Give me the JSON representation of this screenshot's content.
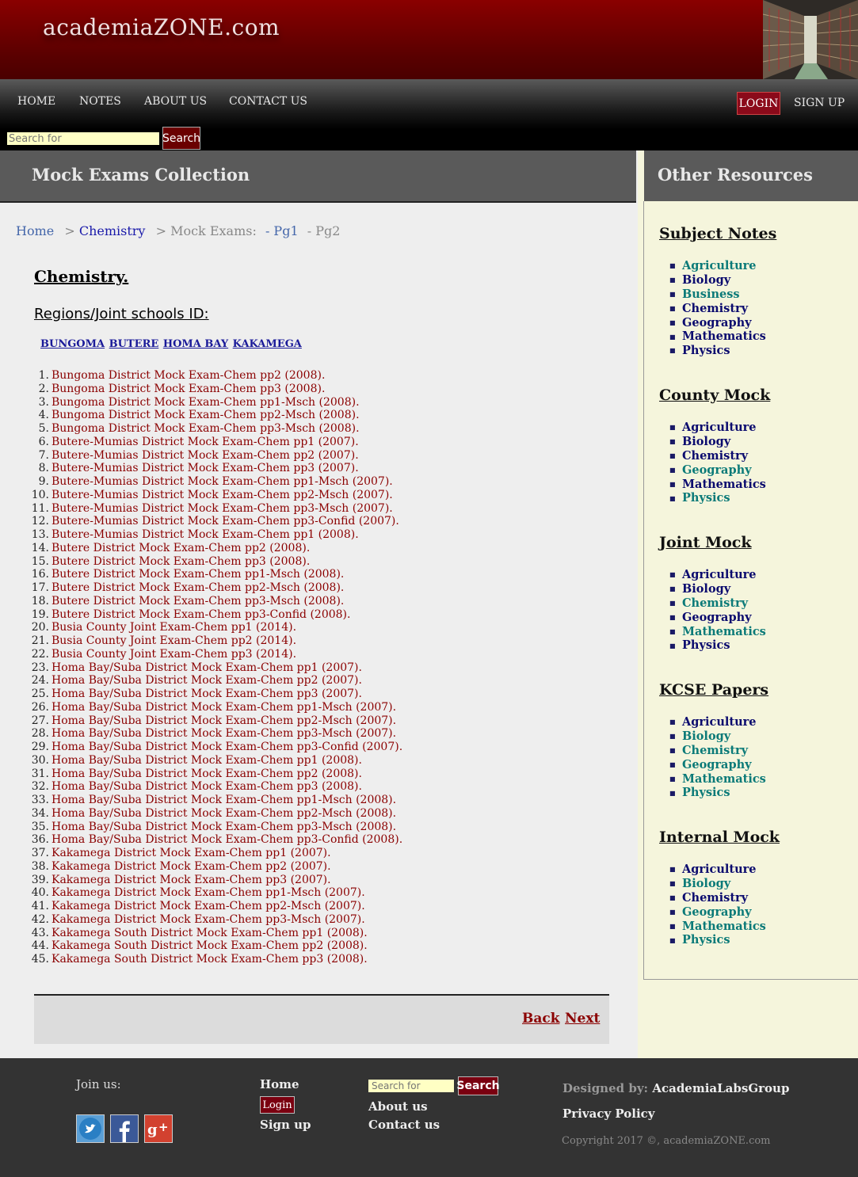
{
  "site": {
    "title": "academiaZONE.com"
  },
  "nav": {
    "items": [
      "HOME",
      "NOTES",
      "ABOUT US",
      "CONTACT US"
    ],
    "login": "LOGIN",
    "signup": "SIGN UP",
    "search_placeholder": "Search for",
    "search_button": "Search"
  },
  "main": {
    "title": "Mock Exams Collection",
    "breadcrumb": {
      "home": "Home",
      "sep": ">",
      "chemistry": "Chemistry",
      "current": "Mock Exams:",
      "pg1": "- Pg1",
      "pg2": "- Pg2"
    },
    "subject_heading": "Chemistry.",
    "regions_heading": "Regions/Joint schools ID:",
    "regions": [
      "BUNGOMA",
      "BUTERE",
      "HOMA BAY",
      "KAKAMEGA"
    ],
    "exams": [
      "Bungoma District Mock Exam-Chem pp2 (2008).",
      "Bungoma District Mock Exam-Chem pp3 (2008).",
      "Bungoma District Mock Exam-Chem pp1-Msch (2008).",
      "Bungoma District Mock Exam-Chem pp2-Msch (2008).",
      "Bungoma District Mock Exam-Chem pp3-Msch (2008).",
      "Butere-Mumias District Mock Exam-Chem pp1 (2007).",
      "Butere-Mumias District Mock Exam-Chem pp2 (2007).",
      "Butere-Mumias District Mock Exam-Chem pp3 (2007).",
      "Butere-Mumias District Mock Exam-Chem pp1-Msch (2007).",
      "Butere-Mumias District Mock Exam-Chem pp2-Msch (2007).",
      "Butere-Mumias District Mock Exam-Chem pp3-Msch (2007).",
      "Butere-Mumias District Mock Exam-Chem pp3-Confid (2007).",
      "Butere-Mumias District Mock Exam-Chem pp1 (2008).",
      "Butere District Mock Exam-Chem pp2 (2008).",
      "Butere District Mock Exam-Chem pp3 (2008).",
      "Butere District Mock Exam-Chem pp1-Msch (2008).",
      "Butere District Mock Exam-Chem pp2-Msch (2008).",
      "Butere District Mock Exam-Chem pp3-Msch (2008).",
      "Butere District Mock Exam-Chem pp3-Confid (2008).",
      "Busia County Joint Exam-Chem pp1 (2014).",
      "Busia County Joint Exam-Chem pp2 (2014).",
      "Busia County Joint Exam-Chem pp3 (2014).",
      "Homa Bay/Suba District Mock Exam-Chem pp1 (2007).",
      "Homa Bay/Suba District Mock Exam-Chem pp2 (2007).",
      "Homa Bay/Suba District Mock Exam-Chem pp3 (2007).",
      "Homa Bay/Suba District Mock Exam-Chem pp1-Msch (2007).",
      "Homa Bay/Suba District Mock Exam-Chem pp2-Msch (2007).",
      "Homa Bay/Suba District Mock Exam-Chem pp3-Msch (2007).",
      "Homa Bay/Suba District Mock Exam-Chem pp3-Confid (2007).",
      "Homa Bay/Suba District Mock Exam-Chem pp1 (2008).",
      "Homa Bay/Suba District Mock Exam-Chem pp2 (2008).",
      "Homa Bay/Suba District Mock Exam-Chem pp3 (2008).",
      "Homa Bay/Suba District Mock Exam-Chem pp1-Msch (2008).",
      "Homa Bay/Suba District Mock Exam-Chem pp2-Msch (2008).",
      "Homa Bay/Suba District Mock Exam-Chem pp3-Msch (2008).",
      "Homa Bay/Suba District Mock Exam-Chem pp3-Confid (2008).",
      "Kakamega District Mock Exam-Chem pp1 (2007).",
      "Kakamega District Mock Exam-Chem pp2 (2007).",
      "Kakamega District Mock Exam-Chem pp3 (2007).",
      "Kakamega District Mock Exam-Chem pp1-Msch (2007).",
      "Kakamega District Mock Exam-Chem pp2-Msch (2007).",
      "Kakamega District Mock Exam-Chem pp3-Msch (2007).",
      "Kakamega South District Mock Exam-Chem pp1 (2008).",
      "Kakamega South District Mock Exam-Chem pp2 (2008).",
      "Kakamega South District Mock Exam-Chem pp3 (2008)."
    ],
    "back": "Back",
    "next": "Next"
  },
  "sidebar": {
    "title": "Other Resources",
    "sections": [
      {
        "title": "Subject Notes",
        "items": [
          {
            "label": "Agriculture",
            "color": "teal"
          },
          {
            "label": "Biology",
            "color": "blue"
          },
          {
            "label": "Business",
            "color": "teal"
          },
          {
            "label": "Chemistry",
            "color": "blue"
          },
          {
            "label": "Geography",
            "color": "blue"
          },
          {
            "label": "Mathematics",
            "color": "blue"
          },
          {
            "label": "Physics",
            "color": "blue"
          }
        ]
      },
      {
        "title": "County Mock",
        "items": [
          {
            "label": "Agriculture",
            "color": "blue"
          },
          {
            "label": "Biology",
            "color": "blue"
          },
          {
            "label": "Chemistry",
            "color": "blue"
          },
          {
            "label": "Geography",
            "color": "teal"
          },
          {
            "label": "Mathematics",
            "color": "blue"
          },
          {
            "label": "Physics",
            "color": "teal"
          }
        ]
      },
      {
        "title": "Joint Mock",
        "items": [
          {
            "label": "Agriculture",
            "color": "blue"
          },
          {
            "label": "Biology",
            "color": "blue"
          },
          {
            "label": "Chemistry",
            "color": "teal"
          },
          {
            "label": "Geography",
            "color": "blue"
          },
          {
            "label": "Mathematics",
            "color": "teal"
          },
          {
            "label": "Physics",
            "color": "blue"
          }
        ]
      },
      {
        "title": "KCSE Papers",
        "items": [
          {
            "label": "Agriculture",
            "color": "blue"
          },
          {
            "label": "Biology",
            "color": "teal"
          },
          {
            "label": "Chemistry",
            "color": "teal"
          },
          {
            "label": "Geography",
            "color": "teal"
          },
          {
            "label": "Mathematics",
            "color": "teal"
          },
          {
            "label": "Physics",
            "color": "teal"
          }
        ]
      },
      {
        "title": "Internal Mock",
        "items": [
          {
            "label": "Agriculture",
            "color": "blue"
          },
          {
            "label": "Biology",
            "color": "teal"
          },
          {
            "label": "Chemistry",
            "color": "blue"
          },
          {
            "label": "Geography",
            "color": "teal"
          },
          {
            "label": "Mathematics",
            "color": "teal"
          },
          {
            "label": "Physics",
            "color": "teal"
          }
        ]
      }
    ]
  },
  "footer": {
    "join_label": "Join us:",
    "social": [
      "twitter-icon",
      "facebook-icon",
      "google-plus-icon"
    ],
    "home": "Home",
    "login": "Login",
    "signup": "Sign up",
    "search_placeholder": "Search for",
    "search_button": "Search",
    "about": "About us",
    "contact": "Contact us",
    "designed_by_label": "Designed by:",
    "designed_by": "AcademiaLabsGroup",
    "privacy": "Privacy Policy",
    "copyright": "Copyright 2017 ©, academiaZONE.com"
  },
  "colors": {
    "brand_red": "#8b0000",
    "link_blue": "#0b0b6e",
    "link_teal": "#0b7a78",
    "sidebar_bg": "#f5f5dc"
  }
}
